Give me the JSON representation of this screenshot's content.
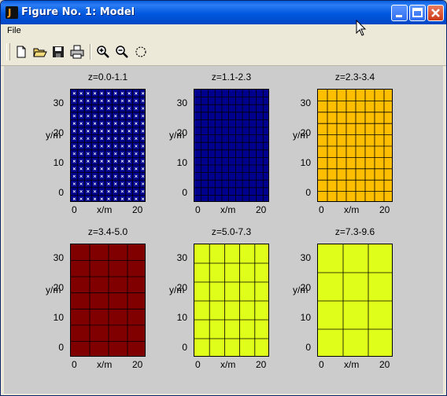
{
  "window": {
    "title": "Figure No. 1: Model",
    "minimize_label": "_",
    "maximize_label": "□",
    "close_label": "✕"
  },
  "menu": {
    "file": "File"
  },
  "toolbar": {
    "buttons": [
      {
        "name": "new-icon"
      },
      {
        "name": "open-icon"
      },
      {
        "name": "save-icon"
      },
      {
        "name": "print-icon"
      },
      {
        "name": "zoom-in-icon"
      },
      {
        "name": "zoom-out-icon"
      },
      {
        "name": "rotate-icon"
      }
    ]
  },
  "figure": {
    "axes_labels": {
      "x": "x/m",
      "y": "y/m"
    },
    "x_ticks": [
      "0",
      "20"
    ],
    "y_ticks": [
      "30",
      "20",
      "10",
      "0"
    ],
    "panels": [
      {
        "title": "z=0.0-1.1",
        "color": "#00008f",
        "grid_color": "#000000",
        "marker_color": "#ffffff",
        "markers": true
      },
      {
        "title": "z=1.1-2.3",
        "color": "#00008f",
        "grid_color": "#000000",
        "markers": false
      },
      {
        "title": "z=2.3-3.4",
        "color": "#ffbf00",
        "grid_color": "#000000",
        "markers": false
      },
      {
        "title": "z=3.4-5.0",
        "color": "#800000",
        "grid_color": "#000000",
        "markers": false
      },
      {
        "title": "z=5.0-7.3",
        "color": "#dfff1a",
        "grid_color": "#000000",
        "markers": false
      },
      {
        "title": "z=7.3-9.6",
        "color": "#dfff1a",
        "grid_color": "#000000",
        "markers": false
      }
    ]
  }
}
